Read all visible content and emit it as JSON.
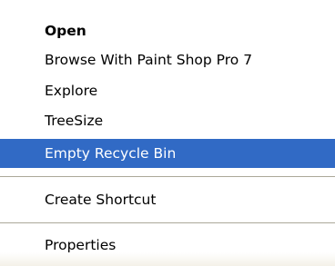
{
  "context_menu": {
    "items": [
      {
        "label": "Open"
      },
      {
        "label": "Browse With Paint Shop Pro 7"
      },
      {
        "label": "Explore"
      },
      {
        "label": "TreeSize"
      },
      {
        "label": "Empty Recycle Bin"
      },
      {
        "label": "Create Shortcut"
      },
      {
        "label": "Properties"
      }
    ],
    "default_item": "Open",
    "highlighted_item": "Empty Recycle Bin"
  },
  "colors": {
    "highlight": "#316ac5",
    "highlight_text": "#ffffff",
    "separator": "#aca899"
  }
}
